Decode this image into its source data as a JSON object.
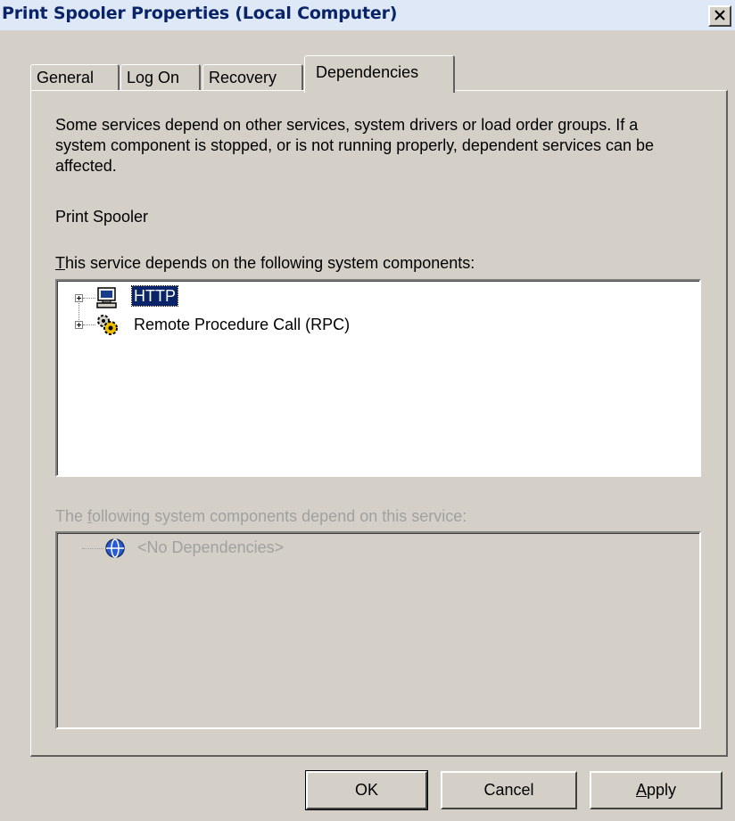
{
  "window": {
    "title": "Print Spooler Properties (Local Computer)"
  },
  "tabs": [
    {
      "label": "General",
      "active": false
    },
    {
      "label": "Log On",
      "active": false
    },
    {
      "label": "Recovery",
      "active": false
    },
    {
      "label": "Dependencies",
      "active": true
    }
  ],
  "dependencies": {
    "description": "Some services depend on other services, system drivers or load order groups. If a system component is stopped, or is not running properly, dependent services can be affected.",
    "service_name": "Print Spooler",
    "depends_on_label_u": "T",
    "depends_on_label_rest": "his service depends on the following system components:",
    "depends_on": [
      {
        "label": "HTTP",
        "icon": "computer-icon",
        "selected": true
      },
      {
        "label": "Remote Procedure Call (RPC)",
        "icon": "gears-icon",
        "selected": false
      }
    ],
    "dependents_label_pre": "The ",
    "dependents_label_u": "f",
    "dependents_label_rest": "ollowing system components depend on this service:",
    "dependents": [
      {
        "label": "<No Dependencies>",
        "icon": "globe-icon"
      }
    ]
  },
  "buttons": {
    "ok": "OK",
    "cancel": "Cancel",
    "apply_u": "A",
    "apply_rest": "pply"
  }
}
